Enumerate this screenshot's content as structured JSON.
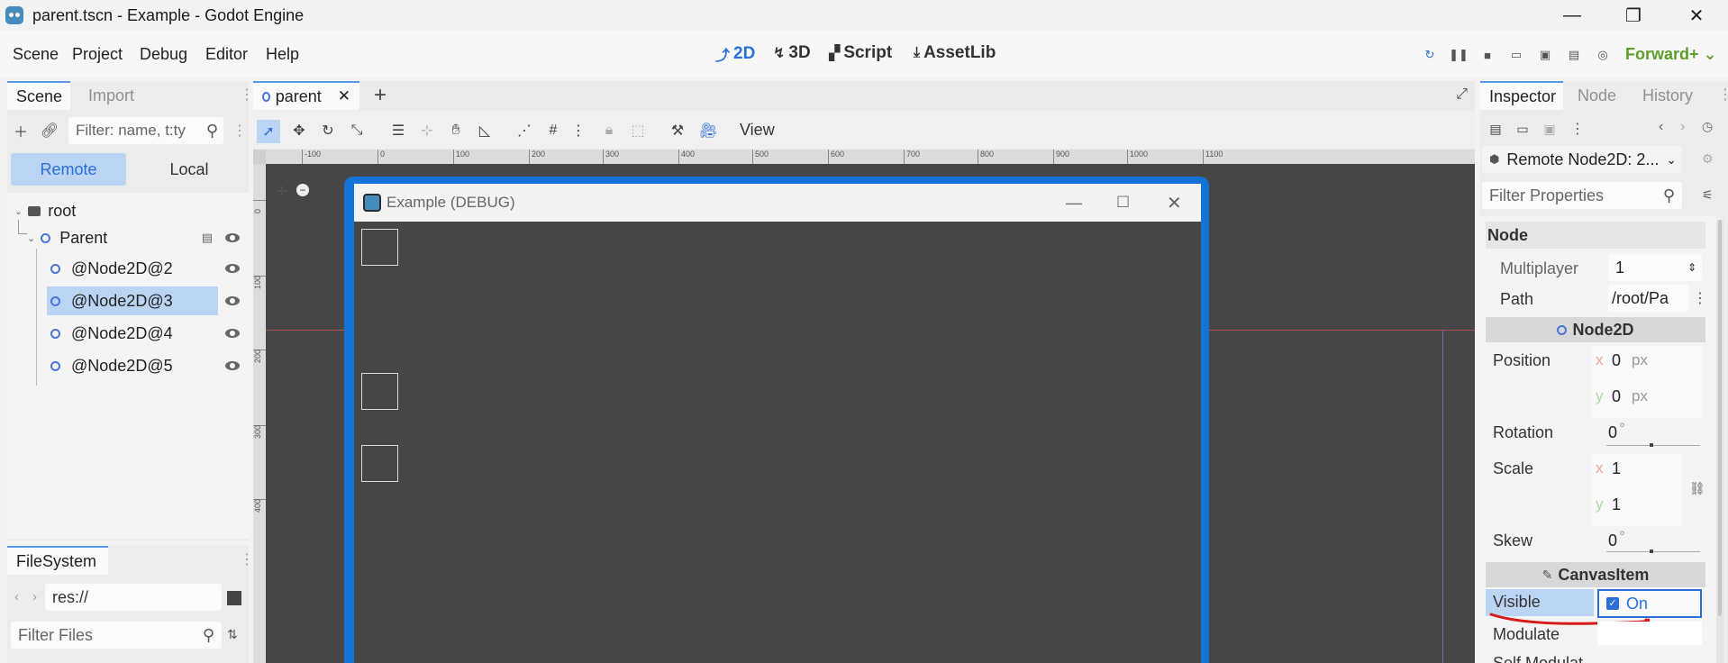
{
  "window": {
    "title": "parent.tscn - Example - Godot Engine",
    "minimize": "—",
    "maximize": "❐",
    "close": "✕"
  },
  "menu": [
    "Scene",
    "Project",
    "Debug",
    "Editor",
    "Help"
  ],
  "workspaces": [
    {
      "label": "2D",
      "glyph": "⤴",
      "active": true
    },
    {
      "label": "3D",
      "glyph": "↯",
      "active": false
    },
    {
      "label": "Script",
      "glyph": "▞",
      "active": false
    },
    {
      "label": "AssetLib",
      "glyph": "⤓",
      "active": false
    }
  ],
  "renderer": "Forward+",
  "scene_dock": {
    "tabs": [
      "Scene",
      "Import"
    ],
    "filter_placeholder": "Filter: name, t:ty",
    "remote_label": "Remote",
    "local_label": "Local",
    "tree": [
      {
        "label": "root",
        "level": 0
      },
      {
        "label": "Parent",
        "level": 1
      },
      {
        "label": "@Node2D@2",
        "level": 2
      },
      {
        "label": "@Node2D@3",
        "level": 2,
        "selected": true
      },
      {
        "label": "@Node2D@4",
        "level": 2
      },
      {
        "label": "@Node2D@5",
        "level": 2
      }
    ]
  },
  "filesystem": {
    "tab": "FileSystem",
    "path": "res://",
    "filter_placeholder": "Filter Files"
  },
  "viewport": {
    "scene_tab": "parent",
    "view_menu": "View",
    "ruler_labels": [
      "-100",
      "0",
      "100",
      "200",
      "300",
      "400",
      "500",
      "600",
      "700",
      "800",
      "900",
      "1000",
      "1100"
    ],
    "ruler_v_labels": [
      "0",
      "100",
      "200",
      "300",
      "400"
    ],
    "debug_title": "Example (DEBUG)"
  },
  "inspector": {
    "tabs": [
      "Inspector",
      "Node",
      "History"
    ],
    "object_label": "Remote Node2D: 2...",
    "filter_placeholder": "Filter Properties",
    "node_section": "Node",
    "multiplayer_label": "Multiplayer",
    "multiplayer_value": "1",
    "path_label": "Path",
    "path_value": "/root/Pa",
    "node2d_section": "Node2D",
    "position_label": "Position",
    "position": {
      "x": "0",
      "y": "0",
      "unit": "px"
    },
    "rotation_label": "Rotation",
    "rotation": "0",
    "scale_label": "Scale",
    "scale": {
      "x": "1",
      "y": "1"
    },
    "skew_label": "Skew",
    "skew": "0",
    "degree": "°",
    "canvasitem_section": "CanvasItem",
    "visible_label": "Visible",
    "visible_value": "On",
    "modulate_label": "Modulate",
    "self_modulate_label": "Self Modulat"
  },
  "colors": {
    "accent": "#2b6fd8",
    "debug_frame": "#1473d6",
    "renderer_green": "#5e9e2c",
    "annotation_red": "#d61a1a"
  }
}
